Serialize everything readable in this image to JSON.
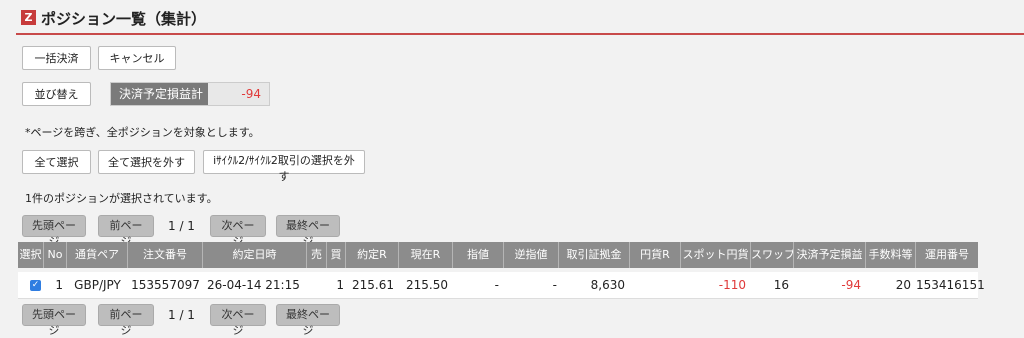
{
  "header": {
    "logo": "Z",
    "title": "ポジション一覧（集計）"
  },
  "buttons": {
    "bulk_settle": "一括決済",
    "cancel": "キャンセル",
    "sort": "並び替え",
    "select_all": "全て選択",
    "deselect_all": "全て選択を外す",
    "deselect_cycle": "iｻｲｸﾙ2/ｻｲｸﾙ2取引の選択を外す"
  },
  "summary": {
    "label": "決済予定損益計",
    "value": "-94"
  },
  "notes": {
    "cross_page": "*ページを跨ぎ、全ポジションを対象とします。",
    "selected_count": "1件のポジションが選択されています。"
  },
  "pagination": {
    "first": "先頭ページ",
    "prev": "前ページ",
    "info": "1 / 1",
    "next": "次ページ",
    "last": "最終ページ"
  },
  "table": {
    "headers": [
      "選択",
      "No",
      "通貨ペア",
      "注文番号",
      "約定日時",
      "売",
      "買",
      "約定R",
      "現在R",
      "指値",
      "逆指値",
      "取引証拠金",
      "円貨R",
      "スポット円貨",
      "スワップ",
      "決済予定損益",
      "手数料等",
      "運用番号"
    ],
    "rows": [
      {
        "checked": true,
        "no": "1",
        "pair": "GBP/JPY",
        "order_no": "153557097",
        "datetime": "26-04-14 21:15",
        "sell": "",
        "buy": "1",
        "exec_rate": "215.61",
        "current_rate": "215.50",
        "limit": "-",
        "stop": "-",
        "margin": "8,630",
        "yen_rate": "",
        "spot_yen": "-110",
        "swap": "16",
        "planned_pl": "-94",
        "fees": "20",
        "op_no": "153416151"
      }
    ]
  },
  "colors": {
    "accent": "#c84a4a",
    "negative": "#e03a3a",
    "check": "#2f7de1"
  }
}
